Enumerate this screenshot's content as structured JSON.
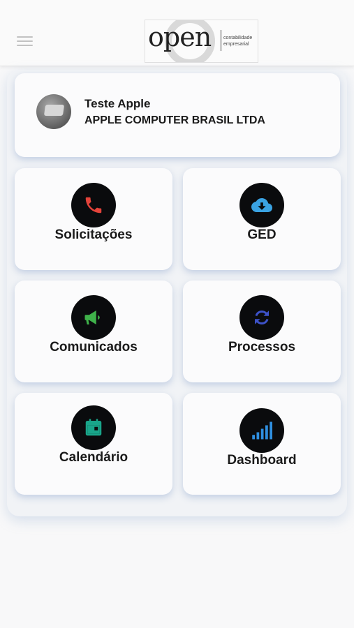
{
  "header": {
    "logo": {
      "word": "open",
      "line1": "contabilidade",
      "line2": "empresarial"
    },
    "menu_icon": "hamburger-menu-icon"
  },
  "profile": {
    "name": "Teste Apple",
    "company": "APPLE COMPUTER BRASIL LTDA"
  },
  "menu": [
    {
      "label": "Solicitações",
      "icon": "phone-icon",
      "color": "#e3433a"
    },
    {
      "label": "GED",
      "icon": "cloud-download-icon",
      "color": "#3aa3e3"
    },
    {
      "label": "Comunicados",
      "icon": "megaphone-icon",
      "color": "#3fb24a"
    },
    {
      "label": "Processos",
      "icon": "sync-icon",
      "color": "#3d52c8"
    },
    {
      "label": "Calendário",
      "icon": "calendar-icon",
      "color": "#19a58a"
    },
    {
      "label": "Dashboard",
      "icon": "signal-bars-icon",
      "color": "#2f8fe0"
    }
  ]
}
